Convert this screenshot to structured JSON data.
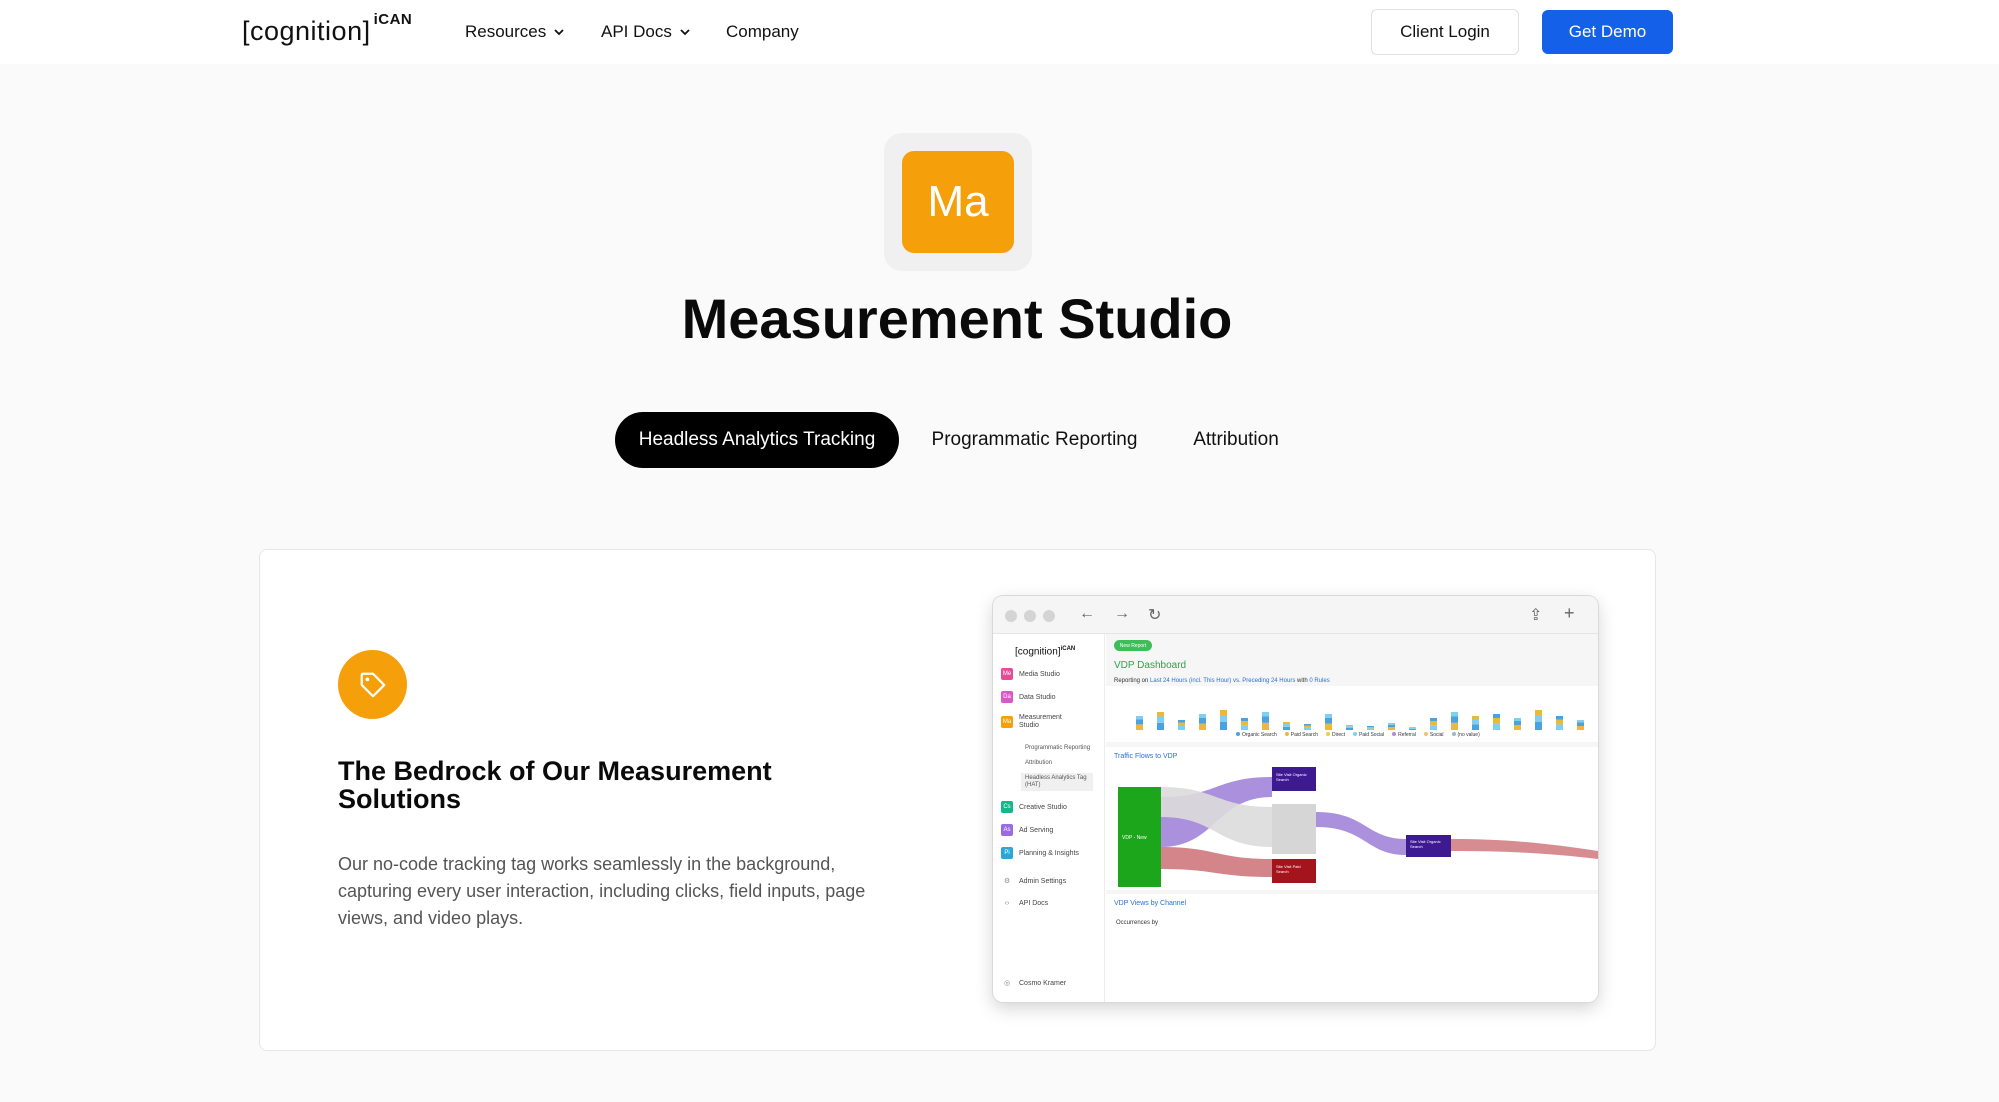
{
  "nav": {
    "logo_text": "[cognition]",
    "logo_sup": "iCAN",
    "items": [
      {
        "label": "Resources"
      },
      {
        "label": "API Docs"
      },
      {
        "label": "Company"
      }
    ],
    "client_login": "Client Login",
    "get_demo": "Get Demo"
  },
  "hero": {
    "app_abbr": "Ma",
    "app_color": "#f59f0b",
    "title": "Measurement Studio"
  },
  "tabs": [
    {
      "label": "Headless Analytics Tracking",
      "active": true
    },
    {
      "label": "Programmatic Reporting",
      "active": false
    },
    {
      "label": "Attribution",
      "active": false
    }
  ],
  "card": {
    "icon": "tag-icon",
    "heading": "The Bedrock of Our Measurement Solutions",
    "body": "Our no-code tracking tag works seamlessly in the background, capturing every user interaction, including clicks, field inputs, page views, and video plays."
  },
  "mock": {
    "logo_text": "[cognition]",
    "logo_sup": "iCAN",
    "sidebar": [
      {
        "abbr": "Me",
        "label": "Media Studio",
        "color": "#e44c97"
      },
      {
        "abbr": "Da",
        "label": "Data Studio",
        "color": "#d957c8"
      },
      {
        "abbr": "Ma",
        "label": "Measurement Studio",
        "color": "#f59f0b"
      },
      {
        "abbr": "Cs",
        "label": "Creative Studio",
        "color": "#19b58a"
      },
      {
        "abbr": "As",
        "label": "Ad Serving",
        "color": "#9b6be0"
      },
      {
        "abbr": "Pi",
        "label": "Planning & Insights",
        "color": "#2aa7d9"
      }
    ],
    "sub_items": [
      "Programmatic Reporting",
      "Attribution",
      "Headless Analytics Tag (HAT)"
    ],
    "admin": "Admin Settings",
    "api_docs": "API Docs",
    "user": "Cosmo Kramer",
    "pill": "New Report",
    "dashboard_title": "VDP Dashboard",
    "reporting_prefix": "Reporting on",
    "reporting_range": "Last 24 Hours (incl. This Hour) vs. Preceding 24 Hours",
    "reporting_mid": "with",
    "reporting_rules": "0 Rules",
    "legend": [
      "Organic Search",
      "Paid Search",
      "Direct",
      "Paid Social",
      "Referral",
      "Social",
      "(no value)"
    ],
    "legend_colors": [
      "#4aa3df",
      "#e8b93c",
      "#f2c94c",
      "#7fd0f0",
      "#b38bd9",
      "#f0c36a",
      "#9fb4d8"
    ],
    "traffic_title": "Traffic Flows to VDP",
    "vdp_views_title": "VDP Views by Channel",
    "occurrences": "Occurrences by",
    "flow_labels": [
      "VDP - New",
      "Site Visit Organic Search",
      "Site Visit Paid Search",
      "Site Visit Organic Search"
    ]
  }
}
